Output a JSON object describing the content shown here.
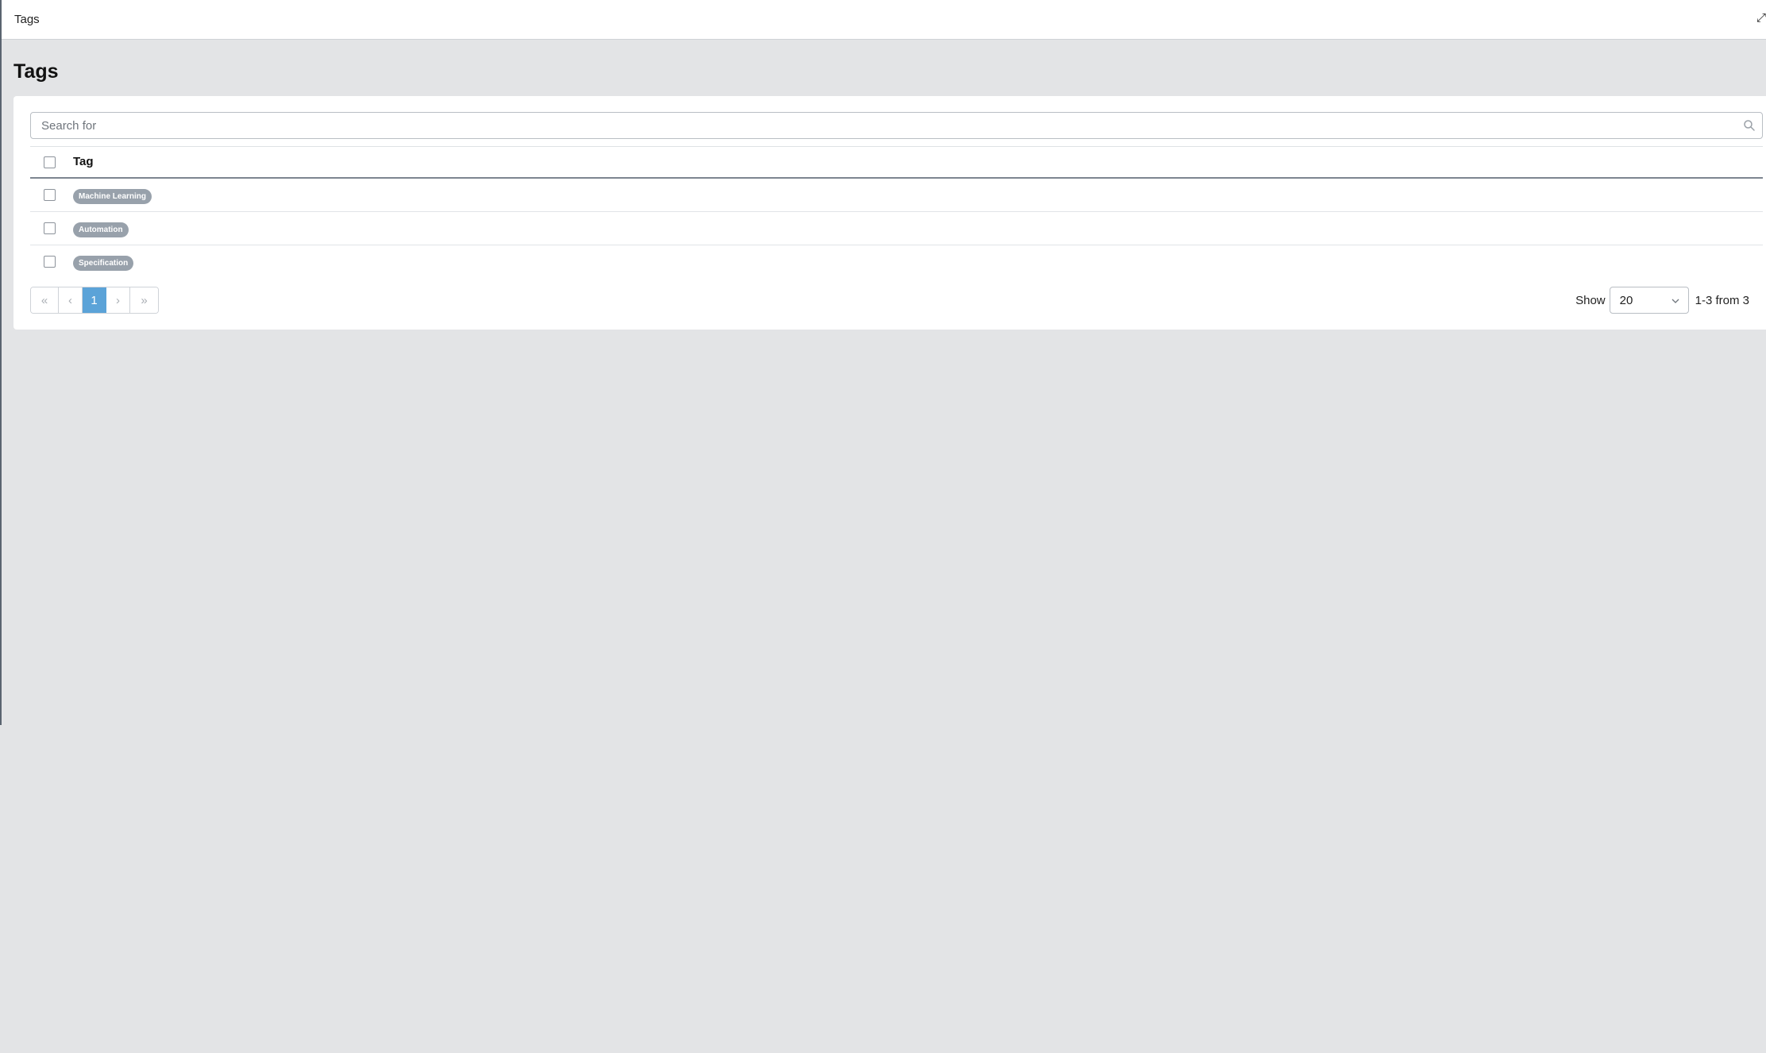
{
  "topbar": {
    "title": "Tags",
    "icon_glyph": "⤢",
    "icon": "expand-icon"
  },
  "page": {
    "title": "Tags"
  },
  "search": {
    "placeholder": "Search for",
    "value": "",
    "icon": "search-icon"
  },
  "table": {
    "header": "Tag",
    "rows": [
      {
        "tag": "Machine Learning"
      },
      {
        "tag": "Automation"
      },
      {
        "tag": "Specification"
      }
    ]
  },
  "pagination": {
    "first_glyph": "«",
    "prev_glyph": "‹",
    "current_page": "1",
    "next_glyph": "›",
    "last_glyph": "»",
    "show_label": "Show",
    "page_size": "20",
    "range_text": "1-3 from 3"
  },
  "colors": {
    "accent": "#5ba3d8",
    "tag_pill": "#98a1ab",
    "background": "#e3e4e6"
  }
}
